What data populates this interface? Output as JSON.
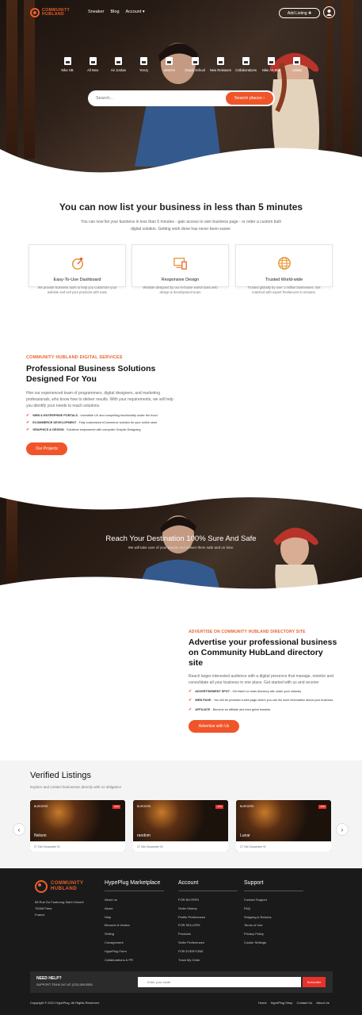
{
  "brand": {
    "name_line1": "COMMUNITY",
    "name_line2": "HUBLAND"
  },
  "nav": {
    "items": [
      "Sneaker",
      "Blog",
      "Account ▾"
    ],
    "add_listing": "Add Listing ✚"
  },
  "hero": {
    "categories": [
      "Nike SB",
      "All New",
      "Air Jordan",
      "Yeezy",
      "Women",
      "Grade School",
      "New Releases",
      "Collaborations",
      "Nike Air Max",
      "Adidas"
    ],
    "search_placeholder": "Search...",
    "search_button": "Search places ›"
  },
  "intro": {
    "title": "You can now list your business in less than 5 minutes",
    "text": "You can now list your business in less than 5 minutes - gain access to own business page - or order a custom built digital solution. Getting work done has never been easier.",
    "features": [
      {
        "title": "Easy-To-Use Dashboard",
        "text": "We provide business tools to help you customize your website and sell your products with ease"
      },
      {
        "title": "Responsive Design",
        "text": "Website designed by our in-house world-class web design & development team"
      },
      {
        "title": "Trusted World-wide",
        "text": "Trusted globally by over 1 million businesses. Get matched with expert freelancers in minutes."
      }
    ]
  },
  "services": {
    "eyebrow": "COMMUNITY HUBLAND DIGITAL SERVICES",
    "title": "Professional Business Solutions Designed For You",
    "text": "Hire our experienced team of programmers, digital designers, and marketing professionals, who know how to deliver results. With your requirements, we will help you identify your needs to reach solutions.",
    "checks": [
      {
        "k": "WEB & ENTERPRISE PORTALS",
        "v": " - Incredible UX and compelling functionality under the hood"
      },
      {
        "k": "ECOMMERCE DEVELOPMENT",
        "v": " - Fully customized eCommerce solution for your online store"
      },
      {
        "k": "GRAPHICS & DESIGN",
        "v": " - Solutions empowered with computer Graphic Designing"
      }
    ],
    "button": "Our Projects"
  },
  "band": {
    "title": "Reach Your Destination 100% Sure And Safe",
    "text": "We will take care of your details and deliver them safe and on time."
  },
  "advertise": {
    "eyebrow": "ADVERTISE ON COMMUNITY HUBLAND DIRECTORY SITE",
    "title": "Advertise your professional business on Community HubLand directory site",
    "text": "Reach larger interested audience with a digital presence that manage, monitor and consolidate all your business in one place. Get started with us and receive:",
    "checks": [
      {
        "k": "ADVERTISEMENT SPOT",
        "v": " - Get listed on main directory site under your industry"
      },
      {
        "k": "WEB PAGE",
        "v": " - You will be provided a web page where you can list more information about your business"
      },
      {
        "k": "AFFILIATE",
        "v": " - Become an affiliate and earn great rewards"
      }
    ],
    "button": "Advertise with Us"
  },
  "listings": {
    "title": "Verified Listings",
    "text": "Explore and contact businesses directly with no obligation",
    "cards": [
      {
        "cat": "BURGERS",
        "tag": "-49%",
        "name": "Nelson",
        "addr": "27 Old Gloucester St"
      },
      {
        "cat": "BURGERS",
        "tag": "-49%",
        "name": "random",
        "addr": "27 Old Gloucester St"
      },
      {
        "cat": "BURGERS",
        "tag": "-49%",
        "name": "Lunar",
        "addr": "27 Old Gloucester St"
      }
    ],
    "prev": "‹",
    "next": "›"
  },
  "footer": {
    "address": [
      "68 Rue Du Faubourg Saint Honoré",
      "75008 Paris",
      "France"
    ],
    "col1_title": "HypePlug Marketplace",
    "col1": [
      "About us",
      "About",
      "Help",
      "Become A Vendor",
      "Selling",
      "Consignment",
      "HypePlug Form",
      "Collaborations & PR"
    ],
    "col2_title": "Account",
    "col2": [
      "FOR BUYERS",
      "Order History",
      "Profile Preferences",
      "FOR SELLERS",
      "Products",
      "Seller Preferences",
      "FOR EVERYONE",
      "Track My Order"
    ],
    "col3_title": "Support",
    "col3": [
      "Contact Support",
      "FAQ",
      "Shipping & Returns",
      "Terms of Use",
      "Privacy Policy",
      "Cookie Settings"
    ],
    "help_title": "NEED HELP?",
    "help_text": "SUPPORT TEAM 24/7 AT (123) 555-5555",
    "email_placeholder": "Enter your email",
    "subscribe": "Subscribe",
    "copyright": "Copyright © 2021 HypePlug. All Rights Reserved.",
    "links": [
      "Home",
      "HypePlug Shop",
      "Contact Us",
      "About Us"
    ]
  },
  "colors": {
    "accent": "#f0552a",
    "dark": "#1a1a1a"
  }
}
